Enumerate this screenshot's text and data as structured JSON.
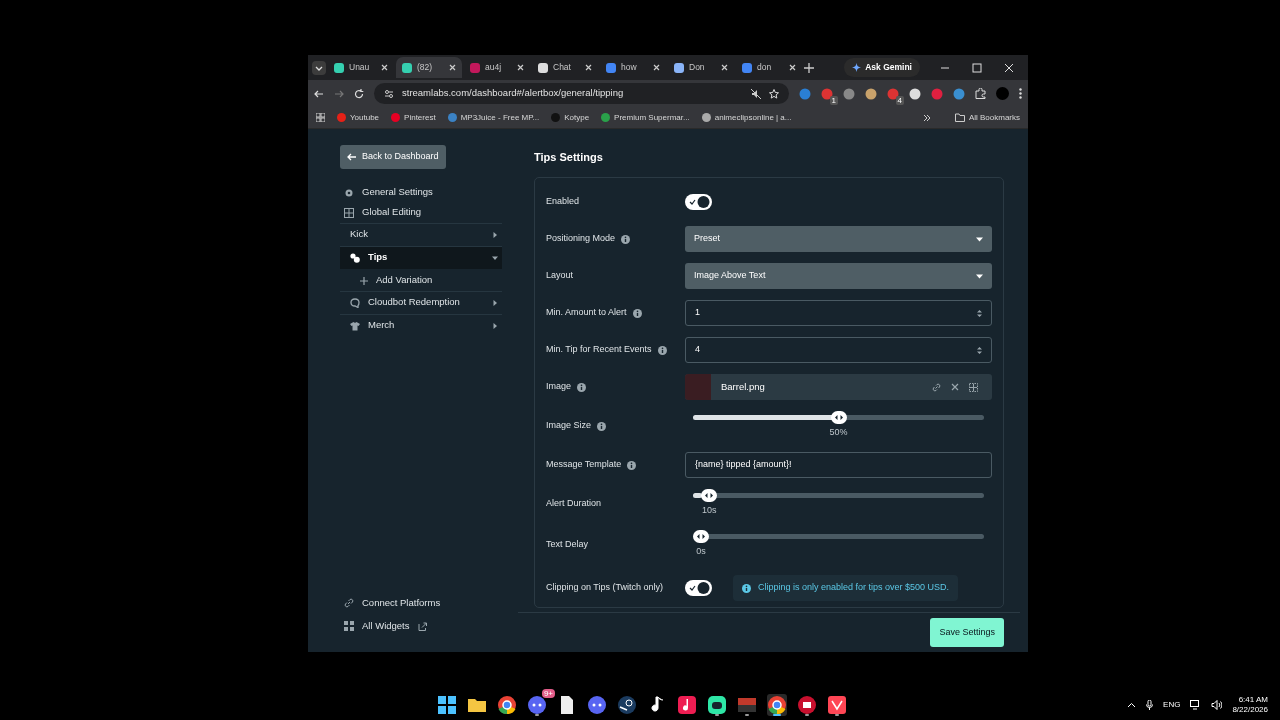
{
  "browser": {
    "tabs": [
      {
        "label": "Unau",
        "selected": false
      },
      {
        "label": "(82)",
        "selected": true
      },
      {
        "label": "au4j",
        "selected": false
      },
      {
        "label": "Chat",
        "selected": false
      },
      {
        "label": "how",
        "selected": false
      },
      {
        "label": "Don",
        "selected": false
      },
      {
        "label": "don",
        "selected": false
      }
    ],
    "gemini_button": "Ask Gemini",
    "url": "streamlabs.com/dashboard#/alertbox/general/tipping",
    "extensions": [
      {
        "kind": "plain"
      },
      {
        "kind": "badged",
        "badge": "1"
      },
      {
        "kind": "plain"
      },
      {
        "kind": "plain"
      },
      {
        "kind": "badged",
        "badge": "4"
      },
      {
        "kind": "plain"
      },
      {
        "kind": "plain"
      },
      {
        "kind": "plain"
      }
    ],
    "bookmarks": [
      "Youtube",
      "Pinterest",
      "MP3Juice - Free MP...",
      "Kotype",
      "Premium Supermar...",
      "animeclipsonline | a..."
    ],
    "all_bookmarks": "All Bookmarks"
  },
  "sidebar": {
    "back_button": "Back to Dashboard",
    "items": [
      {
        "label": "General Settings",
        "kind": "link",
        "selected": false
      },
      {
        "label": "Global Editing",
        "kind": "link",
        "selected": false
      },
      {
        "label": "Kick",
        "kind": "group",
        "expanded": false,
        "selected": false
      },
      {
        "label": "Tips",
        "kind": "group",
        "expanded": true,
        "selected": true,
        "children": [
          {
            "label": "Add Variation",
            "kind": "add",
            "selected": false
          }
        ]
      },
      {
        "label": "Cloudbot Redemption",
        "kind": "group",
        "expanded": false,
        "selected": false
      },
      {
        "label": "Merch",
        "kind": "group",
        "expanded": false,
        "selected": false
      }
    ],
    "footer_links": [
      "Connect Platforms",
      "All Widgets"
    ]
  },
  "settings": {
    "title": "Tips Settings",
    "rows": [
      {
        "kind": "toggle",
        "label": "Enabled",
        "info": false,
        "on": true
      },
      {
        "kind": "select",
        "label": "Positioning Mode",
        "info": true,
        "value": "Preset"
      },
      {
        "kind": "select",
        "label": "Layout",
        "info": false,
        "value": "Image Above Text"
      },
      {
        "kind": "number",
        "label": "Min. Amount to Alert",
        "info": true,
        "value": "1"
      },
      {
        "kind": "number",
        "label": "Min. Tip for Recent Events",
        "info": true,
        "value": "4"
      },
      {
        "kind": "image",
        "label": "Image",
        "info": true,
        "file": "Barrel.png"
      },
      {
        "kind": "slider",
        "label": "Image Size",
        "info": true,
        "level": 0.5,
        "reading": "50%"
      },
      {
        "kind": "text",
        "label": "Message Template",
        "info": true,
        "value": "{name} tipped {amount}!"
      },
      {
        "kind": "slider",
        "label": "Alert Duration",
        "info": false,
        "level": 0.03,
        "reading": "10s"
      },
      {
        "kind": "slider",
        "label": "Text Delay",
        "info": false,
        "level": 0,
        "reading": "0s"
      },
      {
        "kind": "toggle",
        "label": "Clipping on Tips (Twitch only)",
        "info": false,
        "on": true,
        "note": "Clipping is only enabled for tips over $500 USD."
      }
    ],
    "save_button": "Save Settings"
  },
  "taskbar": {
    "apps": [
      {
        "kind": "start",
        "running": false,
        "selected": false
      },
      {
        "kind": "folder",
        "running": false,
        "selected": false
      },
      {
        "kind": "browser",
        "running": false,
        "selected": false
      },
      {
        "kind": "chat",
        "running": true,
        "selected": false,
        "badge": "9+"
      },
      {
        "kind": "file",
        "running": false,
        "selected": false
      },
      {
        "kind": "chat",
        "running": false,
        "selected": false
      },
      {
        "kind": "steam",
        "running": false,
        "selected": false
      },
      {
        "kind": "music",
        "running": false,
        "selected": false
      },
      {
        "kind": "music-pink",
        "running": false,
        "selected": false
      },
      {
        "kind": "green-app",
        "running": true,
        "selected": false
      },
      {
        "kind": "mixer",
        "running": true,
        "selected": false
      },
      {
        "kind": "browser",
        "running": true,
        "selected": true
      },
      {
        "kind": "red-app",
        "running": true,
        "selected": false
      },
      {
        "kind": "game",
        "running": true,
        "selected": false
      }
    ],
    "language": "ENG",
    "time": "6:41 AM",
    "date": "8/22/2026"
  }
}
